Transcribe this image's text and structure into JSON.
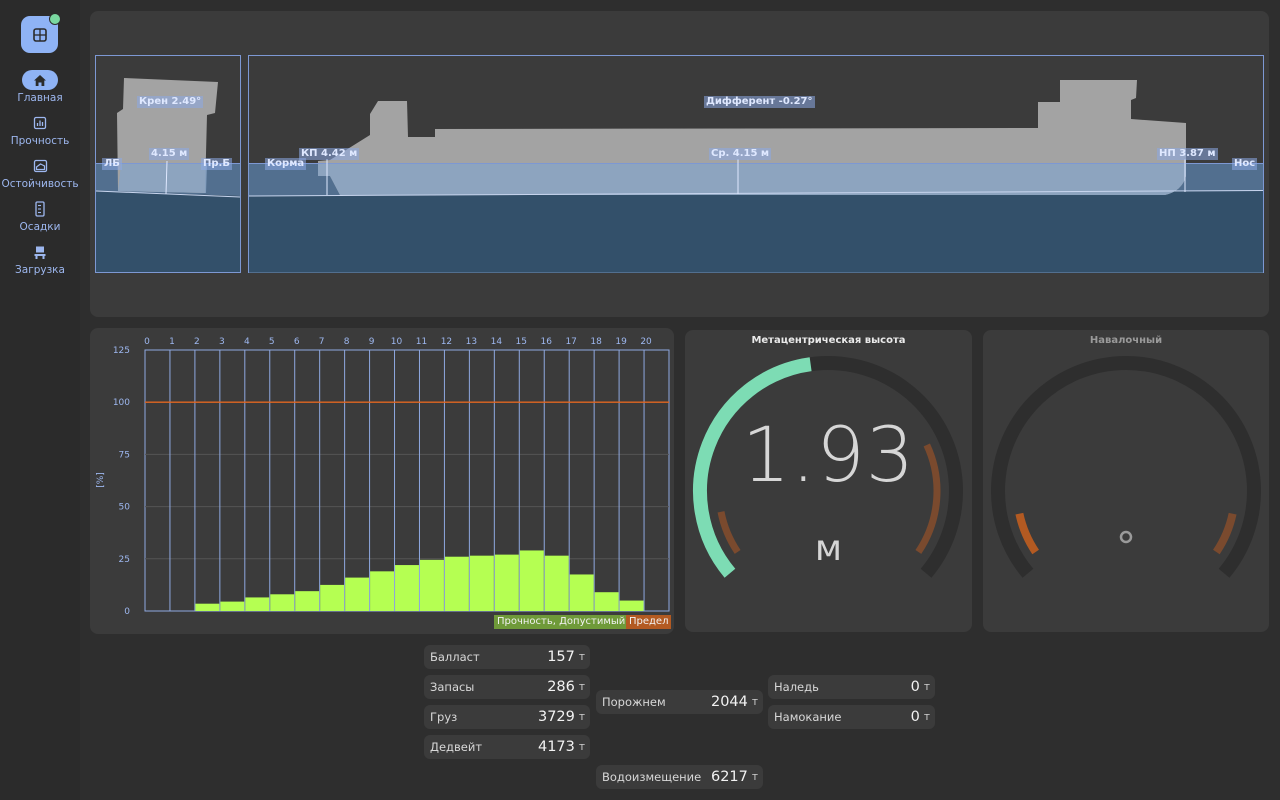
{
  "nav": {
    "items": [
      {
        "label": "Главная",
        "icon": "home-icon",
        "active": true
      },
      {
        "label": "Прочность",
        "icon": "chart-icon",
        "active": false
      },
      {
        "label": "Остойчивость",
        "icon": "stability-icon",
        "active": false
      },
      {
        "label": "Осадки",
        "icon": "ruler-icon",
        "active": false
      },
      {
        "label": "Загрузка",
        "icon": "crane-icon",
        "active": false
      }
    ]
  },
  "ship": {
    "heel_label": "Крен 2.49°",
    "heel_draft": "4.15 м",
    "port_label": "ЛБ",
    "starboard_label": "Пр.Б",
    "trim_label": "Дифферент -0.27°",
    "aft_label": "Корма",
    "bow_label": "Нос",
    "draft_aft": "КП 4.42 м",
    "draft_mid": "Ср. 4.15 м",
    "draft_fwd": "НП 3.87 м"
  },
  "strength": {
    "axis_unit": "[%]",
    "legend_ok": "Прочность, Допустимый",
    "legend_limit": "Предел",
    "colors": {
      "ok": "#b5ff52",
      "limit": "#e0651f",
      "grid": "#8fa8e0"
    }
  },
  "chart_data": {
    "type": "bar",
    "categories": [
      "0",
      "1",
      "2",
      "3",
      "4",
      "5",
      "6",
      "7",
      "8",
      "9",
      "10",
      "11",
      "12",
      "13",
      "14",
      "15",
      "16",
      "17",
      "18",
      "19",
      "20"
    ],
    "frames": [
      "0",
      "1",
      "2",
      "3",
      "4",
      "5",
      "6",
      "7",
      "8",
      "9",
      "10",
      "11",
      "12",
      "13",
      "14",
      "15",
      "16",
      "17",
      "18",
      "19",
      "20"
    ],
    "series": [
      {
        "name": "Прочность, Допустимый",
        "values": [
          0,
          3.5,
          4.5,
          6.5,
          8,
          9.5,
          12.5,
          16,
          19,
          22,
          24.5,
          26,
          26.5,
          27,
          29,
          26.5,
          17.5,
          9,
          5,
          0
        ]
      }
    ],
    "limit": 100,
    "ylabel": "[%]",
    "yticks": [
      0,
      25,
      50,
      75,
      100,
      125
    ],
    "ylim": [
      0,
      125
    ]
  },
  "gauge_metacentric": {
    "title": "Метацентрическая высота",
    "value": "1.93",
    "unit": "м",
    "fill_fraction": 0.47,
    "colors": {
      "fill": "#7ddcb4",
      "warn": "#7a4a2e",
      "track": "#2e2e2e"
    }
  },
  "gauge_bulk": {
    "title": "Навалочный",
    "colors": {
      "warn": "#b35a22",
      "track": "#2e2e2e"
    }
  },
  "stats": {
    "ballast": {
      "label": "Балласт",
      "value": "157",
      "unit": "т"
    },
    "stores": {
      "label": "Запасы",
      "value": "286",
      "unit": "т"
    },
    "cargo": {
      "label": "Груз",
      "value": "3729",
      "unit": "т"
    },
    "deadweight": {
      "label": "Дедвейт",
      "value": "4173",
      "unit": "т"
    },
    "lightship": {
      "label": "Порожнем",
      "value": "2044",
      "unit": "т"
    },
    "displacement": {
      "label": "Водоизмещение",
      "value": "6217",
      "unit": "т"
    },
    "ice": {
      "label": "Наледь",
      "value": "0",
      "unit": "т"
    },
    "wetting": {
      "label": "Намокание",
      "value": "0",
      "unit": "т"
    }
  }
}
